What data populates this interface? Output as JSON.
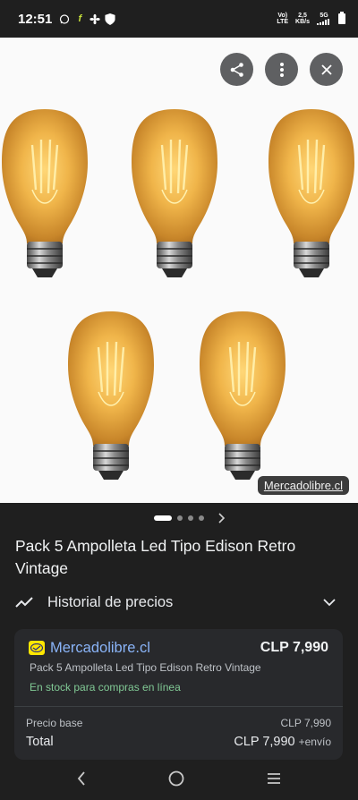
{
  "status_bar": {
    "time": "12:51",
    "network_top": "Vo)",
    "network_bottom": "LTE",
    "speed_top": "2,5",
    "speed_bottom": "KB/s",
    "signal": "5G"
  },
  "image_viewer": {
    "source_chip": "Mercadolibre.cl",
    "slide_count": 4,
    "active_slide": 1
  },
  "product": {
    "title": "Pack 5 Ampolleta Led Tipo Edison Retro Vintage"
  },
  "price_history": {
    "label": "Historial de precios"
  },
  "offer": {
    "store": "Mercadolibre.cl",
    "price": "CLP 7,990",
    "description": "Pack 5 Ampolleta Led Tipo Edison Retro Vintage",
    "stock": "En stock para compras en línea",
    "base_label": "Precio base",
    "base_value": "CLP 7,990",
    "total_label": "Total",
    "total_value": "CLP 7,990",
    "shipping": "+envío"
  },
  "colors": {
    "background": "#1f1f1f",
    "card": "#28292c",
    "link": "#8ab4f8",
    "in_stock": "#81c995",
    "bulb_glass": "#e0a33a"
  }
}
